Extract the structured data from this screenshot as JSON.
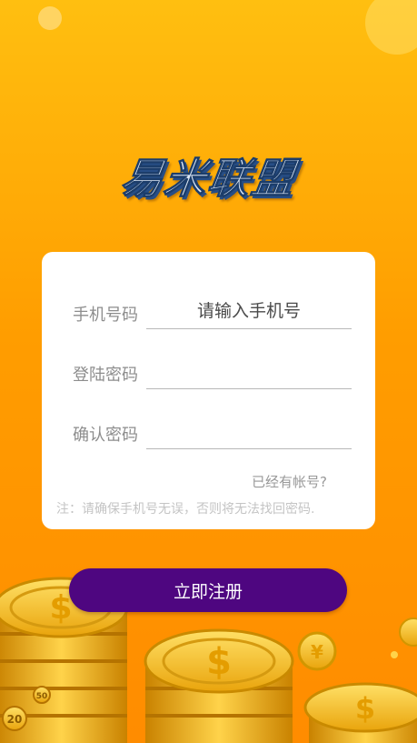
{
  "app": {
    "logo_text": "易米联盟"
  },
  "form": {
    "phone_label": "手机号码",
    "phone_placeholder": "请输入手机号",
    "password_label": "登陆密码",
    "password_value": "",
    "confirm_label": "确认密码",
    "confirm_value": "",
    "have_account_link": "已经有帐号?",
    "note": "注：请确保手机号无误，否则将无法找回密码."
  },
  "actions": {
    "register_label": "立即注册"
  },
  "colors": {
    "background_top": "#ffbf10",
    "background_bottom": "#ff8c00",
    "button": "#4e0680",
    "card": "#ffffff",
    "coin_gold": "#f5c21a"
  },
  "decor": {
    "coin_symbol_dollar": "$",
    "coin_symbol_yuan": "¥",
    "coin_label_20": "20",
    "coin_label_50": "50"
  }
}
